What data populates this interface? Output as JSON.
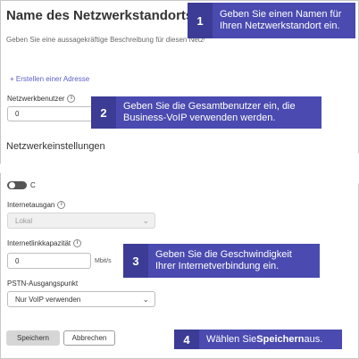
{
  "form": {
    "title": "Name des Netzwerkstandorts",
    "subtitle": "Geben Sie eine aussagekräftige Beschreibung für diesen Netzwerkstandort ein.",
    "add_address_link": "+ Erstellen einer Adresse",
    "network_users": {
      "label": "Netzwerkbenutzer",
      "value": "0"
    },
    "network_settings_title": "Netzwerkeinstellungen",
    "toggle_label": "C",
    "internet_egress": {
      "label": "Internetausgan",
      "value": "Lokal"
    },
    "bandwidth": {
      "label": "Internetlinkkapazität",
      "value": "0",
      "unit": "Mbit/s"
    },
    "pstn_egress": {
      "label": "PSTN-Ausgangspunkt",
      "value": "Nur VoIP verwenden"
    },
    "save_label": "Speichern",
    "cancel_label": "Abbrechen"
  },
  "callouts": [
    {
      "number": "1",
      "text": "Geben Sie einen Namen für Ihren Netzwerkstandort ein."
    },
    {
      "number": "2",
      "text": "Geben Sie die Gesamtbenutzer ein, die Business-VoIP verwenden werden."
    },
    {
      "number": "3",
      "text": "Geben Sie die Geschwindigkeit Ihrer Internetverbindung ein."
    },
    {
      "number": "4",
      "text_before": "Wählen Sie ",
      "text_bold": "Speichern",
      "text_after": " aus."
    }
  ],
  "icons": {
    "info": "info-icon",
    "chevron": "chevron-down-icon",
    "torn_edge": "torn-edge"
  },
  "colors": {
    "callout_number": "#3c3c96",
    "callout_text": "#4a4ab0",
    "link": "#5b5fc7"
  }
}
